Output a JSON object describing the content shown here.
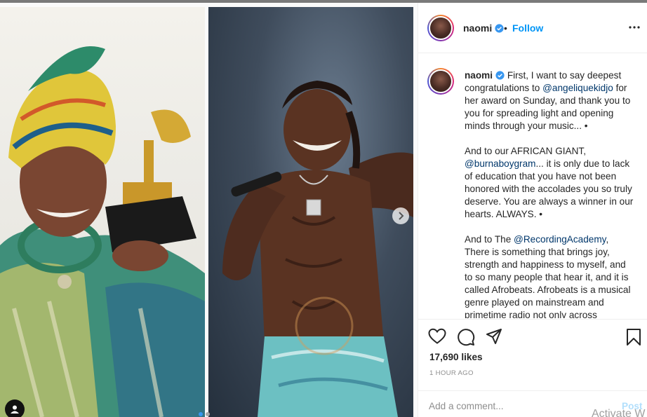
{
  "post": {
    "username": "naomi",
    "follow_label": "Follow",
    "bullet": "•",
    "caption": {
      "username": "naomi",
      "p1_a": "First, I want to say deepest congratulations to ",
      "p1_mention": "@angeliquekidjo",
      "p1_b": " for her award on Sunday, and thank you to you for spreading light and opening minds through your music... •",
      "p2_a": "And to our AFRICAN GIANT, ",
      "p2_mention": "@burnaboygram",
      "p2_b": "... it is only due to lack of education that you have not been honored with the accolades you so truly deserve. You are always a winner in our hearts. ALWAYS. •",
      "p3_a": "And to The ",
      "p3_mention": "@RecordingAcademy",
      "p3_b": ", There is something that brings joy, strength and happiness to myself, and to so many people that hear it, and it is called Afrobeats.  Afrobeats is a musical genre played on mainstream and primetime radio not only across"
    },
    "likes": "17,690 likes",
    "time": "1 HOUR AGO",
    "comment_placeholder": "Add a comment...",
    "post_label": "Post",
    "watermark": "Activate W"
  },
  "icons": {
    "like": "heart-icon",
    "comment": "comment-icon",
    "share": "share-icon",
    "save": "bookmark-icon",
    "more": "more-icon",
    "verified": "verified-icon",
    "next": "chevron-right-icon",
    "tag": "user-tag-icon"
  },
  "colors": {
    "accent": "#0095f6",
    "mention": "#00376b",
    "muted": "#8e8e8e",
    "verified": "#3897f0"
  }
}
